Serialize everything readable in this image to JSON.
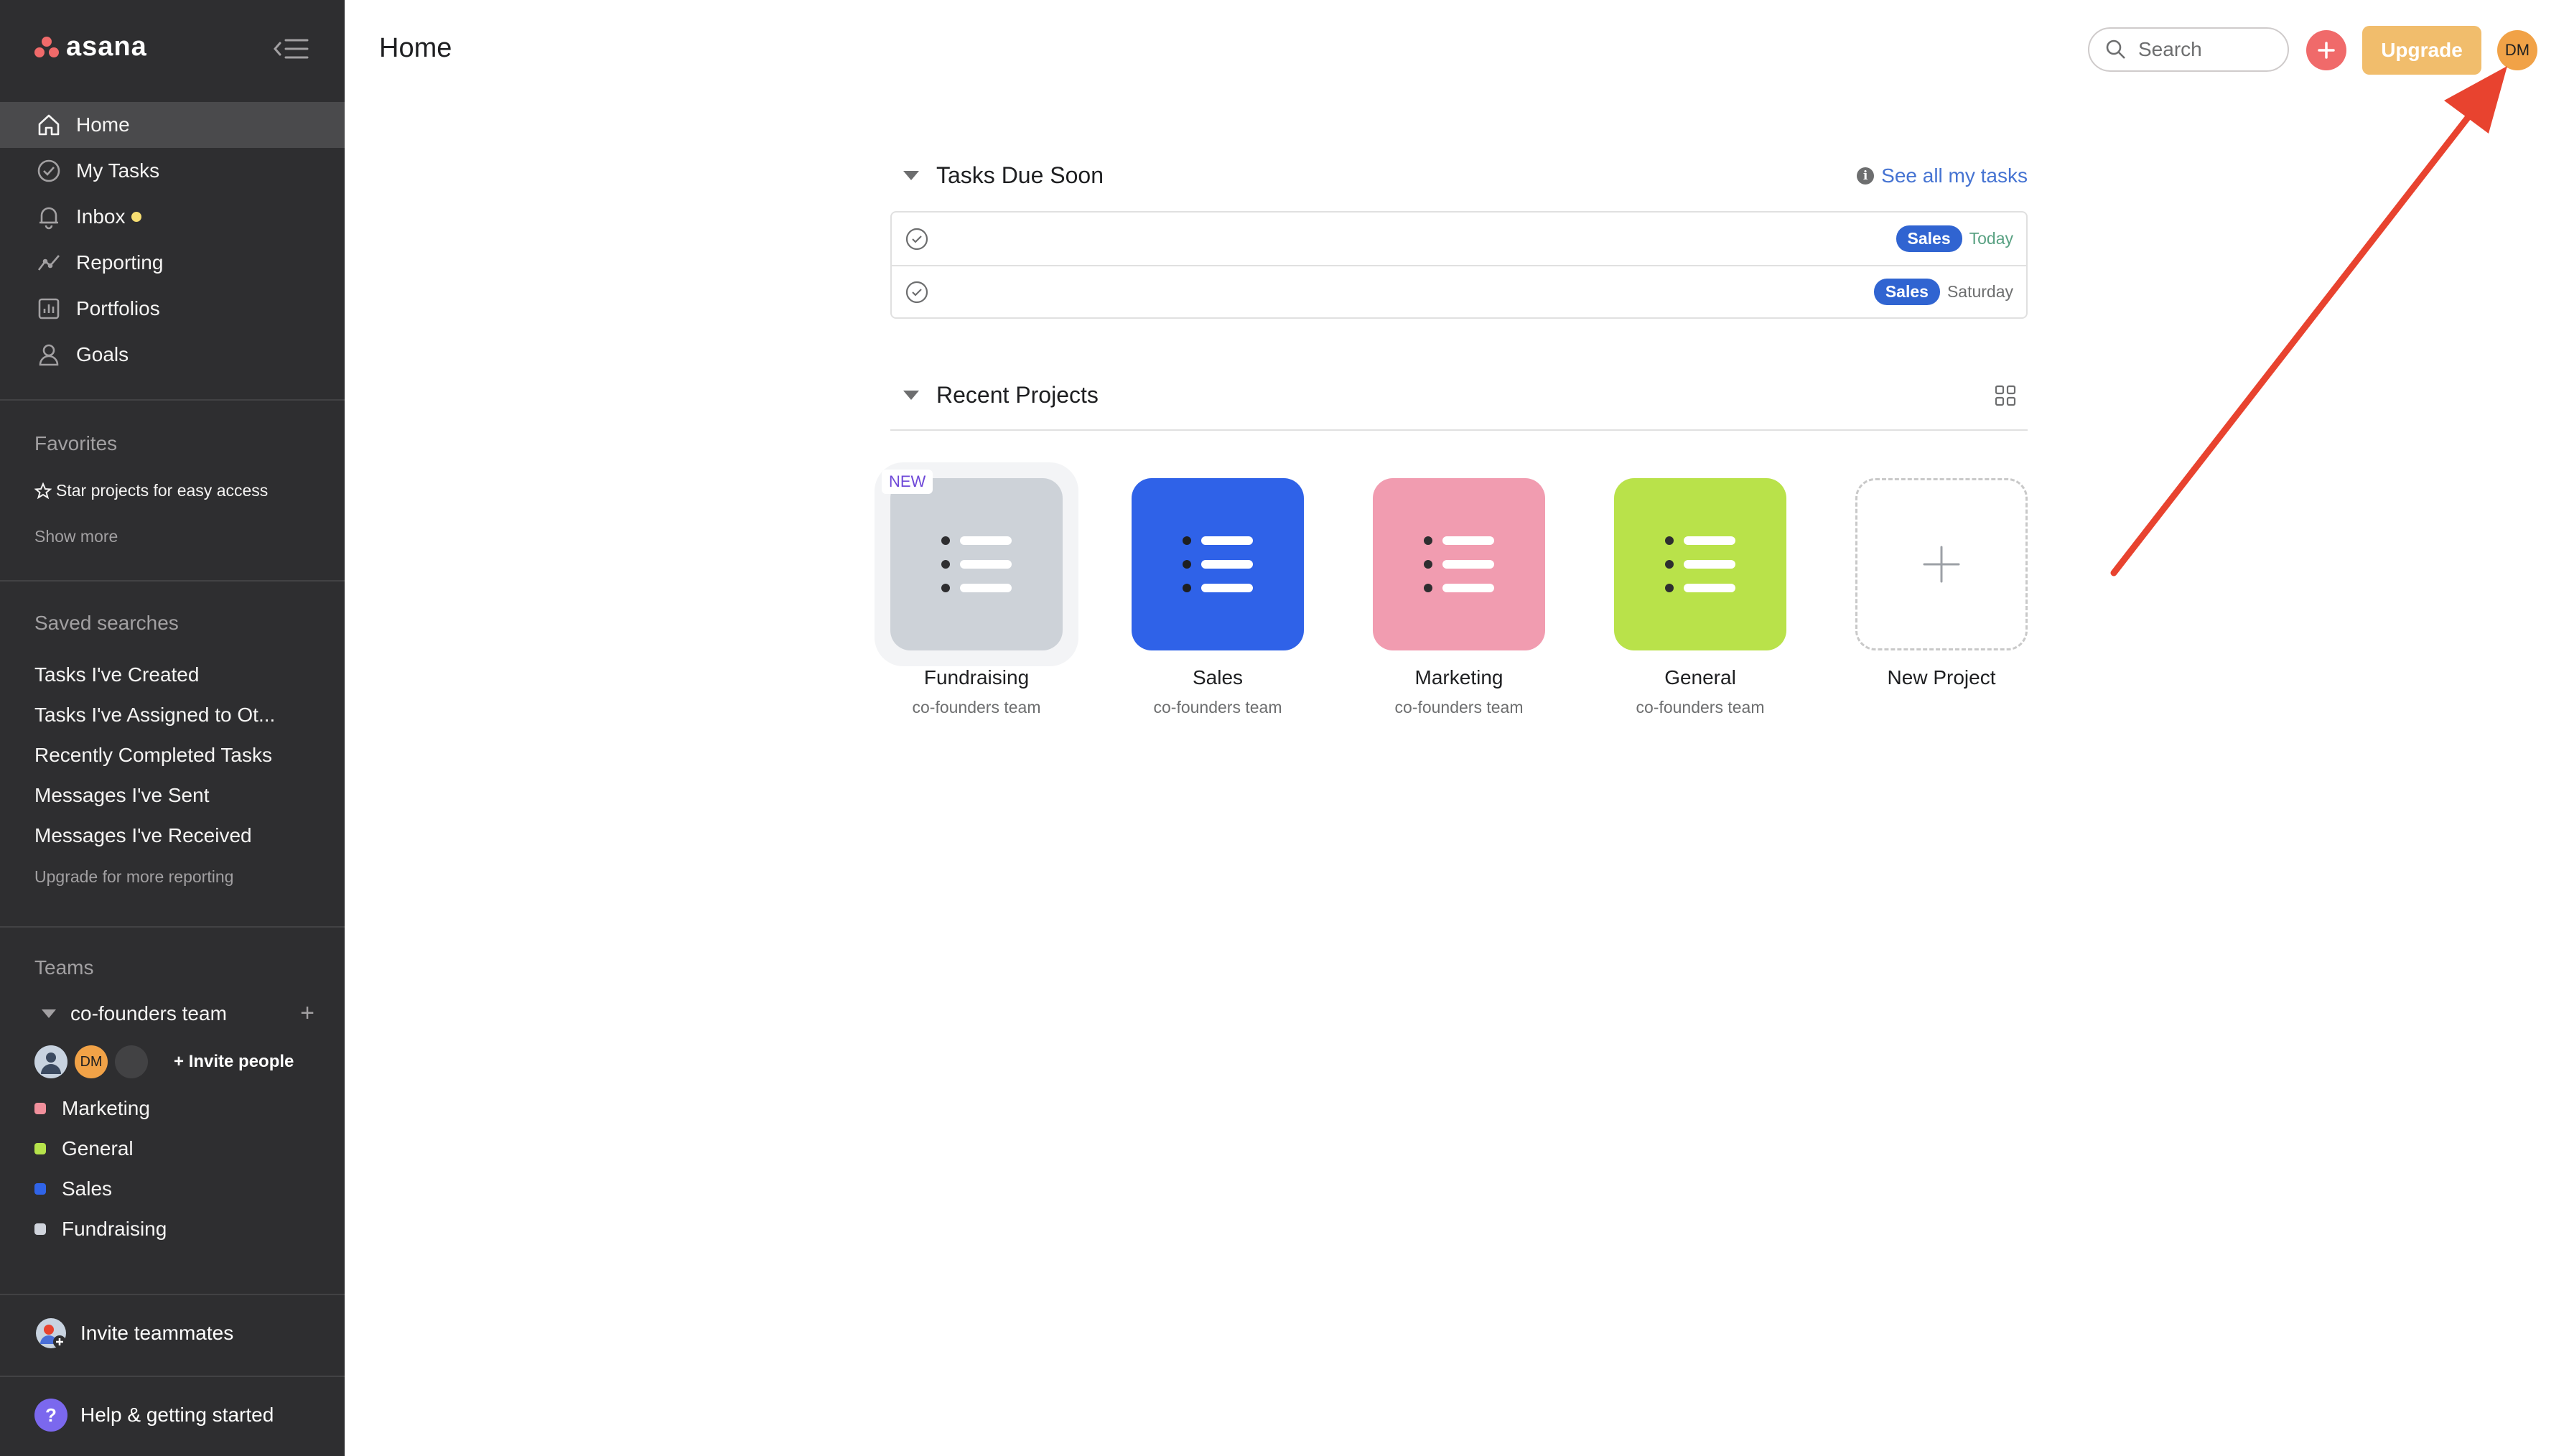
{
  "app": {
    "logo_text": "asana"
  },
  "sidebar": {
    "nav": [
      {
        "label": "Home",
        "icon": "home-icon"
      },
      {
        "label": "My Tasks",
        "icon": "check-circle-icon"
      },
      {
        "label": "Inbox",
        "icon": "bell-icon"
      },
      {
        "label": "Reporting",
        "icon": "chart-line-icon"
      },
      {
        "label": "Portfolios",
        "icon": "bar-chart-icon"
      },
      {
        "label": "Goals",
        "icon": "person-icon"
      }
    ],
    "favorites": {
      "title": "Favorites",
      "hint": "Star projects for easy access",
      "show_more": "Show more"
    },
    "saved_searches": {
      "title": "Saved searches",
      "items": [
        "Tasks I've Created",
        "Tasks I've Assigned to Ot...",
        "Recently Completed Tasks",
        "Messages I've Sent",
        "Messages I've Received"
      ],
      "upgrade_link": "Upgrade for more reporting"
    },
    "teams": {
      "title": "Teams",
      "team_name": "co-founders team",
      "member_initials": "DM",
      "invite_people": "Invite people",
      "projects": [
        {
          "name": "Marketing",
          "color": "#f1909c"
        },
        {
          "name": "General",
          "color": "#b6e34b"
        },
        {
          "name": "Sales",
          "color": "#3064e8"
        },
        {
          "name": "Fundraising",
          "color": "#d0d4dc"
        }
      ]
    },
    "invite_teammates": "Invite teammates",
    "help": "Help & getting started"
  },
  "header": {
    "title": "Home",
    "search_placeholder": "Search",
    "upgrade_label": "Upgrade",
    "avatar_initials": "DM"
  },
  "tasks_due": {
    "title": "Tasks Due Soon",
    "see_all": "See all my tasks",
    "rows": [
      {
        "tag": "Sales",
        "due": "Today",
        "due_color": "#58a182"
      },
      {
        "tag": "Sales",
        "due": "Saturday",
        "due_color": "#6d6e6f"
      }
    ]
  },
  "recent_projects": {
    "title": "Recent Projects",
    "new_badge": "NEW",
    "projects": [
      {
        "name": "Fundraising",
        "team": "co-founders team",
        "color": "#cdd2d8"
      },
      {
        "name": "Sales",
        "team": "co-founders team",
        "color": "#2f62e8"
      },
      {
        "name": "Marketing",
        "team": "co-founders team",
        "color": "#f19cb0"
      },
      {
        "name": "General",
        "team": "co-founders team",
        "color": "#b9e24a"
      }
    ],
    "new_project": "New Project"
  },
  "colors": {
    "sidebar_bg": "#2e2e30",
    "accent_red": "#f06a6a",
    "upgrade": "#f1bd6c",
    "annotation_arrow": "#e8432f"
  }
}
